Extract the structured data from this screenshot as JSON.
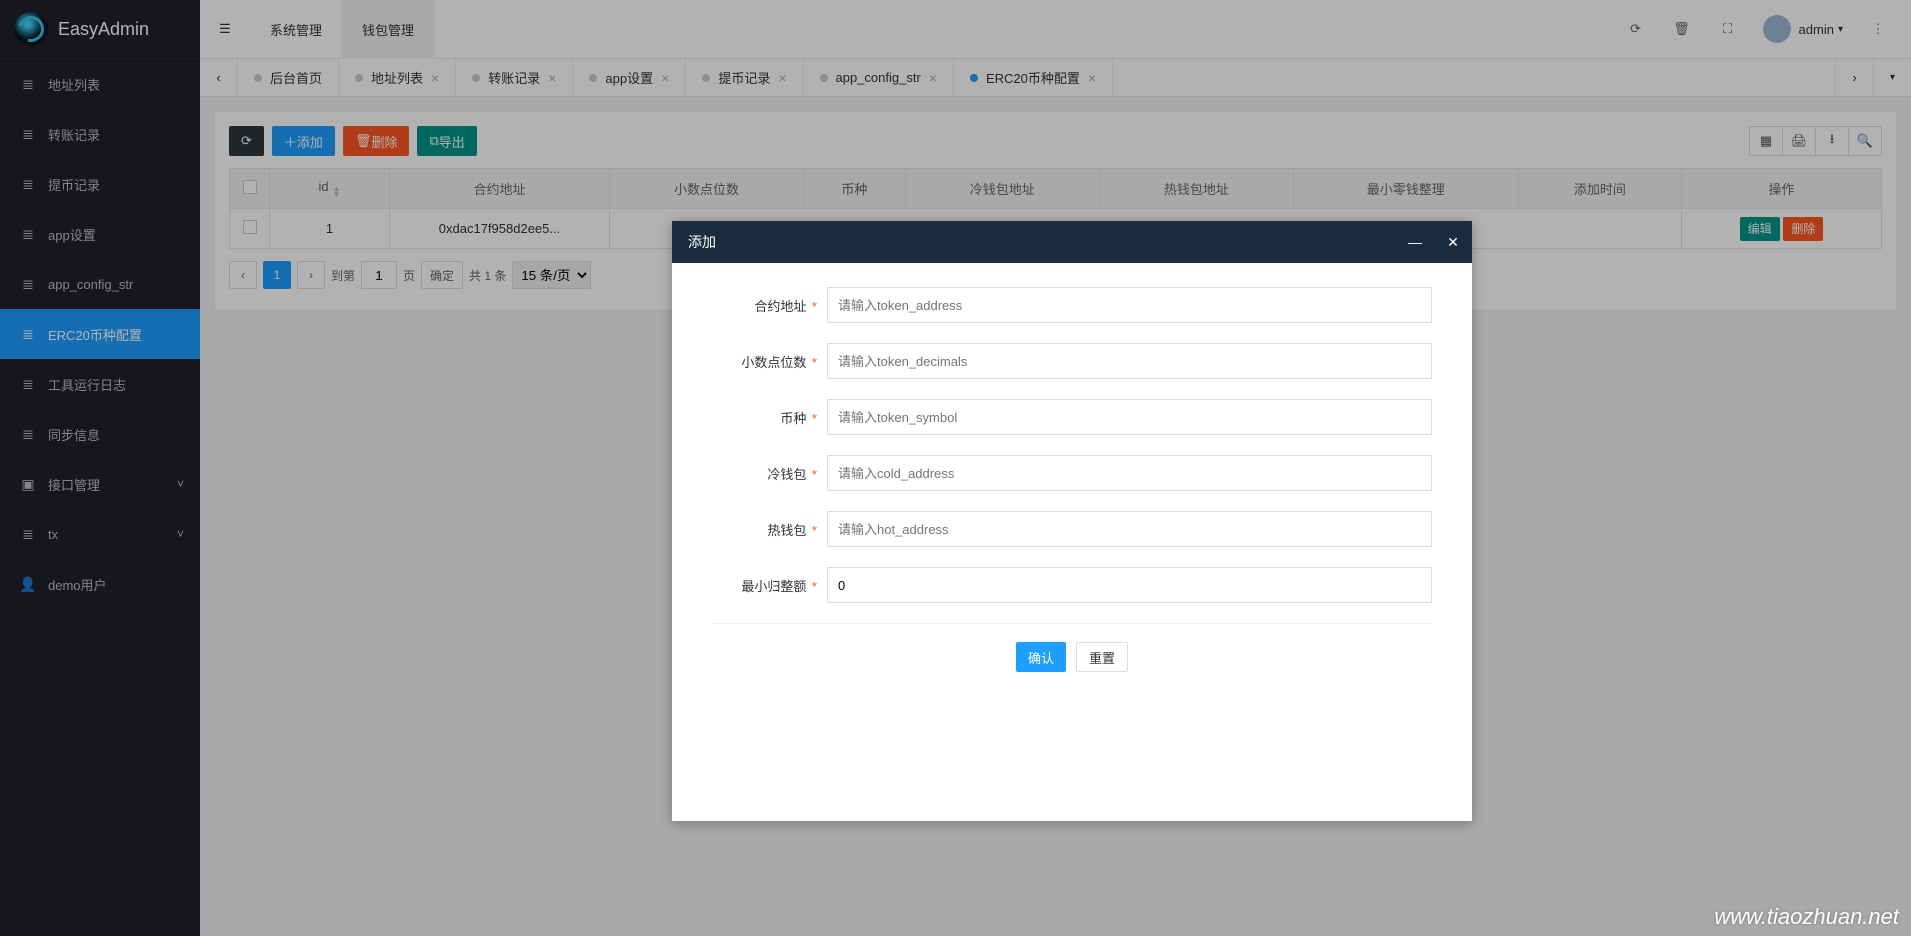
{
  "brand": "EasyAdmin",
  "sidebar": {
    "items": [
      {
        "label": "地址列表",
        "icon": "list"
      },
      {
        "label": "转账记录",
        "icon": "list"
      },
      {
        "label": "提币记录",
        "icon": "list"
      },
      {
        "label": "app设置",
        "icon": "list"
      },
      {
        "label": "app_config_str",
        "icon": "list"
      },
      {
        "label": "ERC20币种配置",
        "icon": "list",
        "active": true
      },
      {
        "label": "工具运行日志",
        "icon": "list"
      },
      {
        "label": "同步信息",
        "icon": "list"
      },
      {
        "label": "接口管理",
        "icon": "layers",
        "expandable": true
      },
      {
        "label": "tx",
        "icon": "list",
        "expandable": true
      },
      {
        "label": "demo用户",
        "icon": "user"
      }
    ]
  },
  "header": {
    "nav": [
      {
        "label": "系统管理"
      },
      {
        "label": "钱包管理",
        "active": true
      }
    ],
    "user": "admin"
  },
  "tabs": [
    {
      "label": "后台首页",
      "closable": false
    },
    {
      "label": "地址列表",
      "closable": true
    },
    {
      "label": "转账记录",
      "closable": true
    },
    {
      "label": "app设置",
      "closable": true
    },
    {
      "label": "提币记录",
      "closable": true
    },
    {
      "label": "app_config_str",
      "closable": true
    },
    {
      "label": "ERC20币种配置",
      "closable": true,
      "active": true
    }
  ],
  "toolbar": {
    "add": "添加",
    "delete": "删除",
    "export": "导出"
  },
  "table": {
    "headers": [
      "",
      "id",
      "合约地址",
      "小数点位数",
      "币种",
      "冷钱包地址",
      "热钱包地址",
      "最小零钱整理",
      "添加时间",
      "操作"
    ],
    "row": {
      "id": "1",
      "address": "0xdac17f958d2ee5...",
      "edit": "编辑",
      "delete": "删除"
    }
  },
  "pager": {
    "page": "1",
    "goto_label": "到第",
    "page_unit": "页",
    "confirm": "确定",
    "total": "共 1 条",
    "per_page": "15 条/页"
  },
  "modal": {
    "title": "添加",
    "fields": [
      {
        "label": "合约地址",
        "placeholder": "请输入token_address",
        "value": ""
      },
      {
        "label": "小数点位数",
        "placeholder": "请输入token_decimals",
        "value": ""
      },
      {
        "label": "币种",
        "placeholder": "请输入token_symbol",
        "value": ""
      },
      {
        "label": "冷钱包",
        "placeholder": "请输入cold_address",
        "value": ""
      },
      {
        "label": "热钱包",
        "placeholder": "请输入hot_address",
        "value": ""
      },
      {
        "label": "最小归整额",
        "placeholder": "",
        "value": "0"
      }
    ],
    "confirm": "确认",
    "reset": "重置"
  },
  "watermark": "www.tiaozhuan.net"
}
